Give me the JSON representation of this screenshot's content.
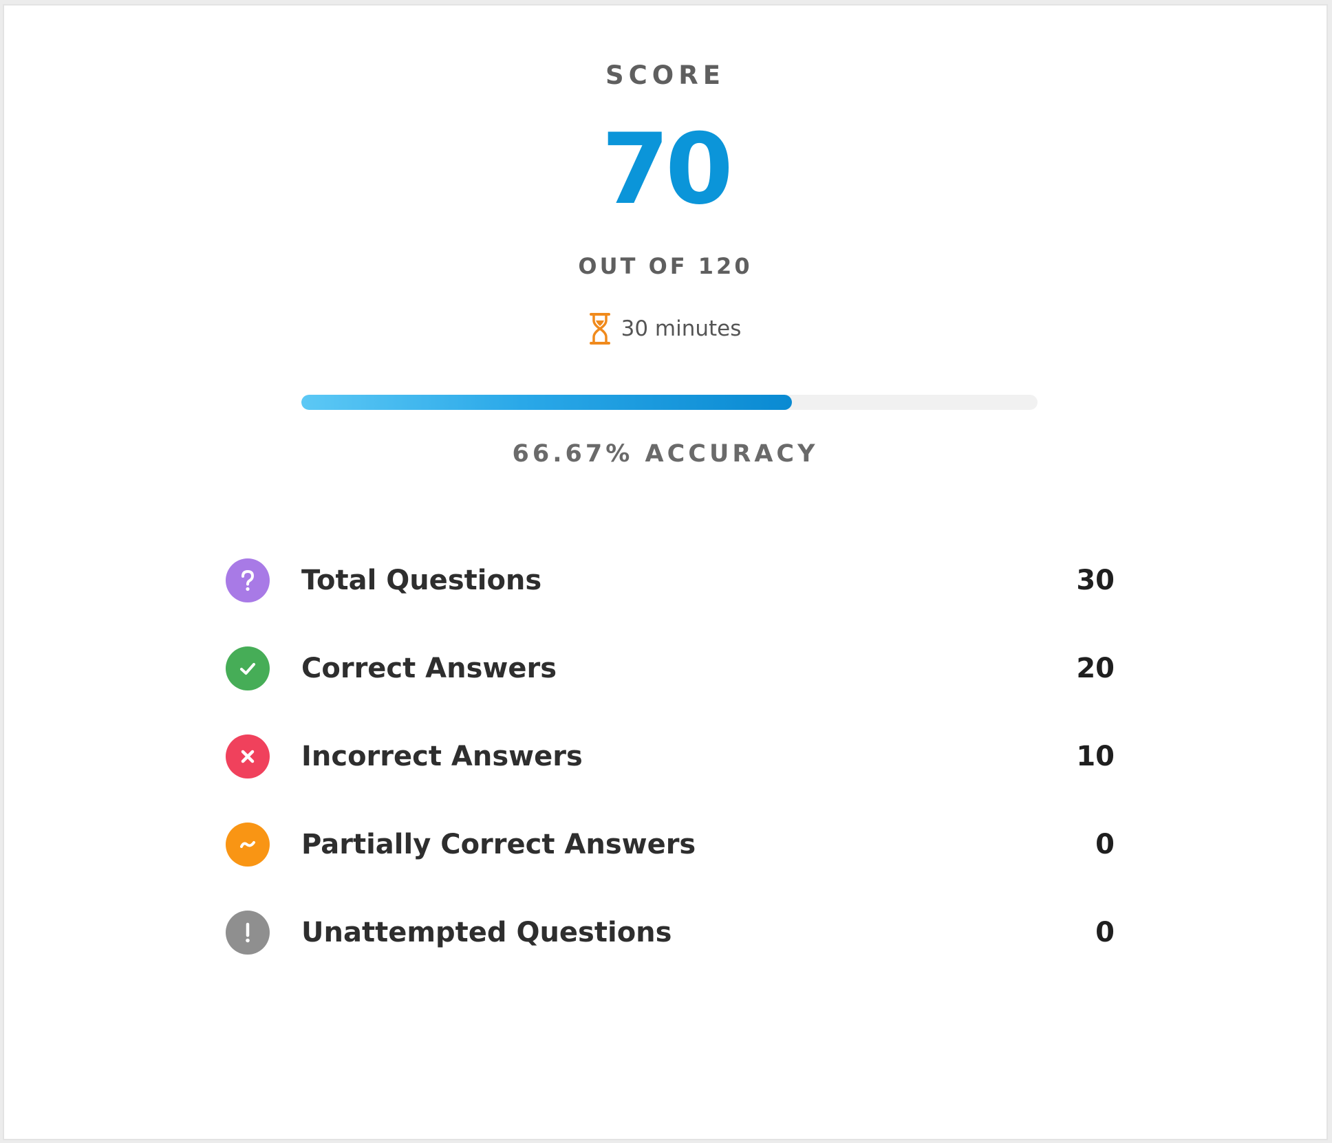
{
  "score": {
    "label": "SCORE",
    "value": "70",
    "out_of": "OUT OF 120",
    "time": "30 minutes",
    "accuracy_text": "66.67% ACCURACY",
    "accuracy_fraction": 0.6667
  },
  "colors": {
    "score_blue": "#0b95d9",
    "hourglass": "#f08a1c",
    "purple": "#a87ae6",
    "green": "#46ad57",
    "red": "#f0415c",
    "orange": "#f99514",
    "gray": "#8f8f8f"
  },
  "stats": [
    {
      "icon": "question-icon",
      "label": "Total Questions",
      "value": "30"
    },
    {
      "icon": "check-icon",
      "label": "Correct Answers",
      "value": "20"
    },
    {
      "icon": "cross-icon",
      "label": "Incorrect Answers",
      "value": "10"
    },
    {
      "icon": "tilde-icon",
      "label": "Partially Correct Answers",
      "value": "0"
    },
    {
      "icon": "exclamation-icon",
      "label": "Unattempted Questions",
      "value": "0"
    }
  ]
}
